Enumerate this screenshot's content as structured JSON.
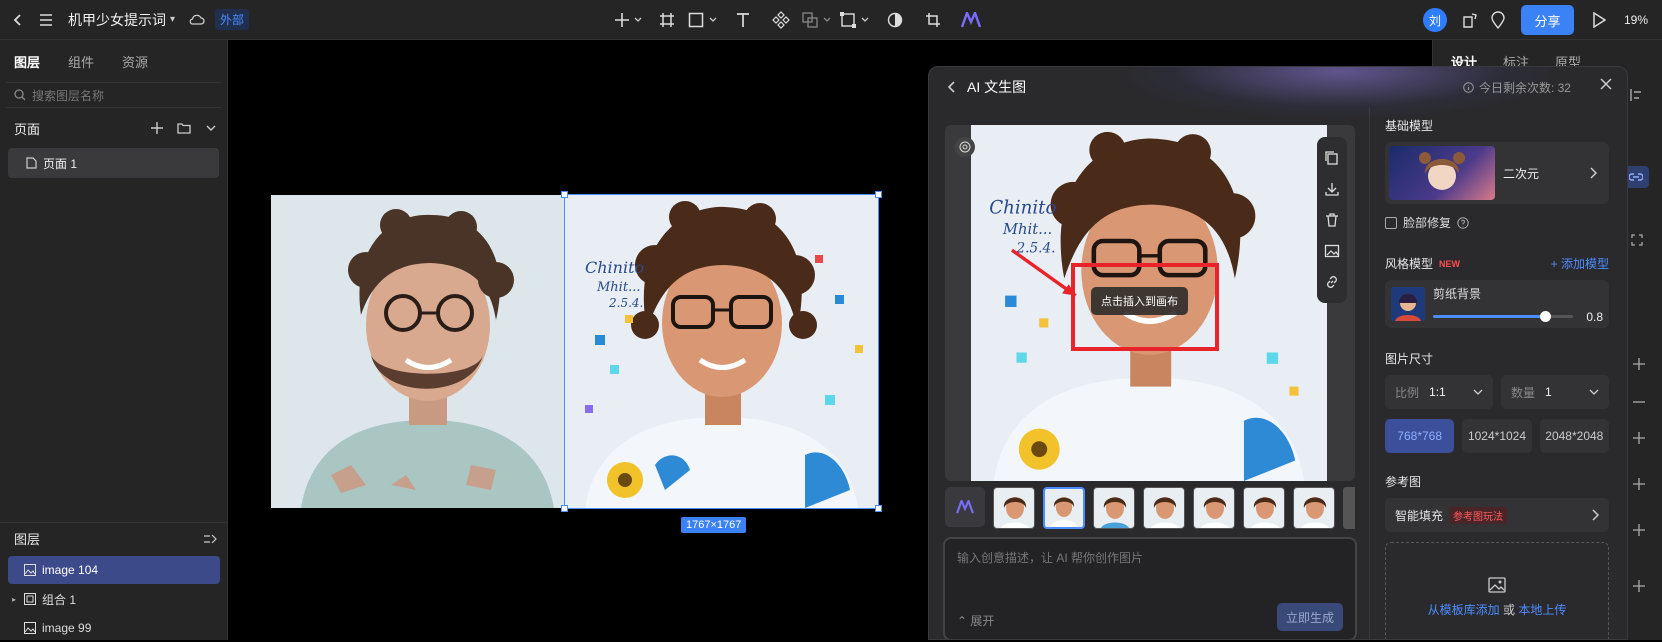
{
  "topbar": {
    "project_title": "机甲少女提示词",
    "external_badge": "外部",
    "avatar_initial": "刘",
    "share_label": "分享",
    "zoom": "19%"
  },
  "left_panel": {
    "tabs": [
      "图层",
      "组件",
      "资源"
    ],
    "search_placeholder": "搜索图层名称",
    "pages_title": "页面",
    "page_item": "页面 1",
    "layers_title": "图层",
    "layers": [
      "image 104",
      "组合 1",
      "image 99"
    ]
  },
  "canvas": {
    "size_tag": "1767×1767"
  },
  "right_panel": {
    "tabs": [
      "设计",
      "标注",
      "原型"
    ]
  },
  "modal": {
    "title": "AI 文生图",
    "quota": "今日剩余次数: 32",
    "tooltip": "点击插入到画布",
    "prompt_placeholder": "输入创意描述，让 AI 帮你创作图片",
    "expand_label": "展开",
    "generate_label": "立即生成",
    "base_model_label": "基础模型",
    "base_model_name": "二次元",
    "face_fix_label": "脸部修复",
    "style_model_label": "风格模型",
    "new_badge": "NEW",
    "add_model_label": "+ 添加模型",
    "style_name": "剪纸背景",
    "style_weight": "0.8",
    "style_weight_value": 0.8,
    "image_size_label": "图片尺寸",
    "ratio_key": "比例",
    "ratio_value": "1:1",
    "count_key": "数量",
    "count_value": "1",
    "sizes": [
      "768*768",
      "1024*1024",
      "2048*2048"
    ],
    "ref_label": "参考图",
    "smart_fill_label": "智能填充",
    "smart_fill_tag": "参考图玩法",
    "upload_from_template": "从模板库添加",
    "upload_or": "或",
    "upload_local": "本地上传",
    "canvas_text": "Chinito\nMhit...\n2.5.4."
  },
  "colors": {
    "accent": "#3b82f6",
    "annotation_red": "#e8232a",
    "selected_layer": "#3d4a8a"
  }
}
